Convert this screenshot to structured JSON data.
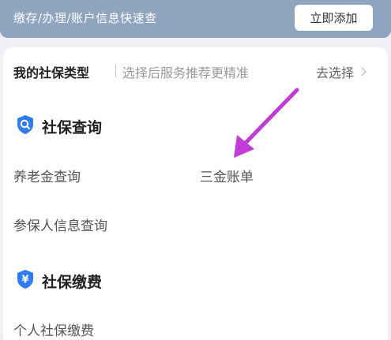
{
  "banner": {
    "text": "缴存/办理/账户信息快速查",
    "add_button": "立即添加"
  },
  "type_row": {
    "title": "我的社保类型",
    "hint": "选择后服务推荐更精准",
    "choose": "去选择"
  },
  "sections": [
    {
      "title": "社保查询",
      "icon": "search-shield-icon",
      "items": [
        "养老金查询",
        "三金账单",
        "参保人信息查询"
      ]
    },
    {
      "title": "社保缴费",
      "icon": "yen-shield-icon",
      "items": [
        "个人社保缴费"
      ]
    }
  ],
  "colors": {
    "banner": "#8fa4bf",
    "accent_blue": "#2f7bf0",
    "annotation_arrow": "#c23bd9"
  }
}
